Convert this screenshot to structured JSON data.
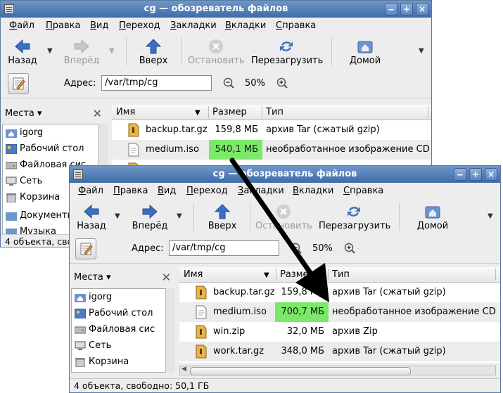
{
  "colors": {
    "title_bar": "#4f7bb6",
    "highlight": "#7be86a",
    "window_bg": "#ededed"
  },
  "back_window": {
    "title": "cg — обозреватель файлов",
    "menu": [
      "Файл",
      "Правка",
      "Вид",
      "Переход",
      "Закладки",
      "Вкладки",
      "Справка"
    ],
    "toolbar": {
      "back": "Назад",
      "forward": "Вперёд",
      "up": "Вверх",
      "stop": "Остановить",
      "reload": "Перезагрузить",
      "home": "Домой"
    },
    "address_label": "Адрес:",
    "address_value": "/var/tmp/cg",
    "zoom": "50%",
    "sidebar_title": "Места",
    "places": [
      "igorg",
      "Рабочий стол",
      "Файловая сис",
      "Сеть",
      "Корзина",
      "Документы",
      "Музыка"
    ],
    "columns": {
      "name": "Имя",
      "size": "Размер",
      "type": "Тип"
    },
    "files": [
      {
        "name": "backup.tar.gz",
        "size": "159,8 МБ",
        "type": "архив Tar (сжатый gzip)"
      },
      {
        "name": "medium.iso",
        "size": "540,1 МБ",
        "type": "необработанное изображение CD"
      }
    ],
    "status": "4 объекта, своб"
  },
  "front_window": {
    "title": "cg — обозреватель файлов",
    "menu": [
      "Файл",
      "Правка",
      "Вид",
      "Переход",
      "Закладки",
      "Вкладки",
      "Справка"
    ],
    "toolbar": {
      "back": "Назад",
      "forward": "Вперёд",
      "up": "Вверх",
      "stop": "Остановить",
      "reload": "Перезагрузить",
      "home": "Домой"
    },
    "address_label": "Адрес:",
    "address_value": "/var/tmp/cg",
    "zoom": "50%",
    "sidebar_title": "Места",
    "places": [
      "igorg",
      "Рабочий стол",
      "Файловая сис",
      "Сеть",
      "Корзина"
    ],
    "columns": {
      "name": "Имя",
      "size": "Размер",
      "type": "Тип"
    },
    "files": [
      {
        "name": "backup.tar.gz",
        "size": "159,8 МБ",
        "type": "архив Tar (сжатый gzip)"
      },
      {
        "name": "medium.iso",
        "size": "700,7 МБ",
        "type": "необработанное изображение CD"
      },
      {
        "name": "win.zip",
        "size": "32,0 МБ",
        "type": "архив Zip"
      },
      {
        "name": "work.tar.gz",
        "size": "348,0 МБ",
        "type": "архив Tar (сжатый gzip)"
      }
    ],
    "status": "4 объекта, свободно: 50,1 ГБ"
  }
}
